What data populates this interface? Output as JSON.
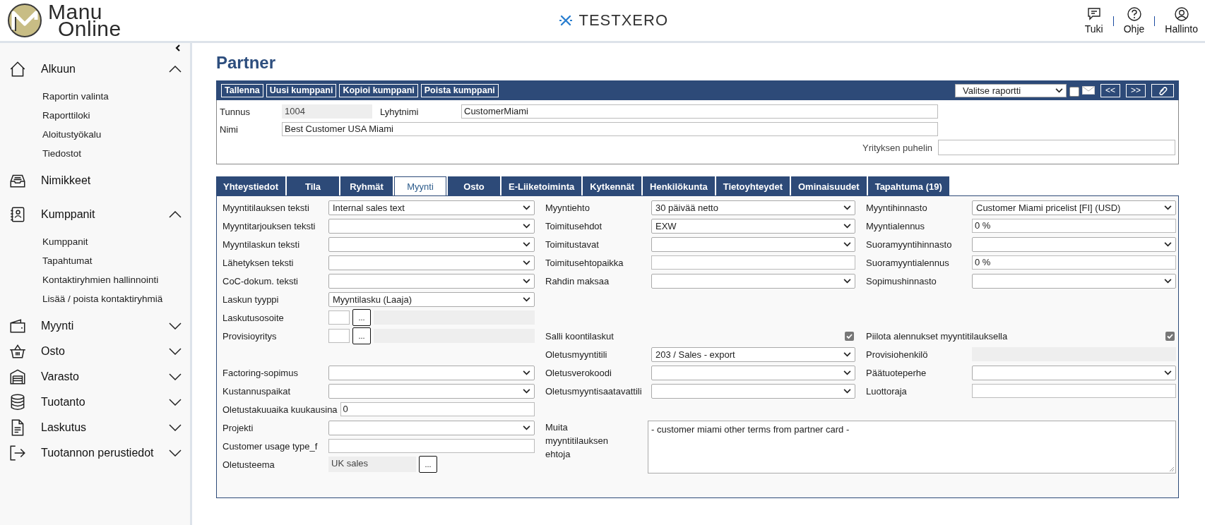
{
  "header": {
    "logo_text": [
      "Manu",
      "Online"
    ],
    "company": "TESTXERO",
    "links": [
      {
        "label": "Tuki"
      },
      {
        "label": "Ohje"
      },
      {
        "label": "Hallinto"
      }
    ]
  },
  "sidebar": {
    "items": [
      {
        "label": "Alkuun",
        "kind": "group",
        "expanded": true,
        "children": [
          {
            "label": "Raportin valinta"
          },
          {
            "label": "Raporttiloki"
          },
          {
            "label": "Aloitustyökalu"
          },
          {
            "label": "Tiedostot"
          }
        ]
      },
      {
        "label": "Nimikkeet",
        "kind": "link"
      },
      {
        "label": "Kumppanit",
        "kind": "group",
        "expanded": true,
        "children": [
          {
            "label": "Kumppanit"
          },
          {
            "label": "Tapahtumat"
          },
          {
            "label": "Kontaktiryhmien hallinnointi"
          },
          {
            "label": "Lisää / poista kontaktiryhmiä"
          }
        ]
      },
      {
        "label": "Myynti",
        "kind": "group",
        "expanded": false
      },
      {
        "label": "Osto",
        "kind": "group",
        "expanded": false
      },
      {
        "label": "Varasto",
        "kind": "group",
        "expanded": false
      },
      {
        "label": "Tuotanto",
        "kind": "group",
        "expanded": false
      },
      {
        "label": "Laskutus",
        "kind": "group",
        "expanded": false
      },
      {
        "label": "Tuotannon perustiedot",
        "kind": "group",
        "expanded": false
      }
    ]
  },
  "page": {
    "title": "Partner"
  },
  "toolbar": {
    "buttons": [
      "Tallenna",
      "Uusi kumppani",
      "Kopioi kumppani",
      "Poista kumppani"
    ],
    "report_select": {
      "value": "Valitse raportti"
    },
    "email_checkbox": {
      "checked": false
    },
    "nav_buttons": [
      "<<",
      ">>"
    ]
  },
  "header_fields": {
    "tunnus": {
      "label": "Tunnus",
      "value": "1004"
    },
    "lyhytnimi": {
      "label": "Lyhytnimi",
      "value": "CustomerMiami"
    },
    "nimi": {
      "label": "Nimi",
      "value": "Best Customer USA Miami"
    },
    "puhelin": {
      "label": "Yrityksen puhelin"
    }
  },
  "tabs": [
    {
      "label": "Yhteystiedot",
      "selected": false
    },
    {
      "label": "Tila",
      "selected": false
    },
    {
      "label": "Ryhmät",
      "selected": false
    },
    {
      "label": "Myynti",
      "selected": true
    },
    {
      "label": "Osto",
      "selected": false
    },
    {
      "label": "E-Liiketoiminta",
      "selected": false
    },
    {
      "label": "Kytkennät",
      "selected": false
    },
    {
      "label": "Henkilökunta",
      "selected": false
    },
    {
      "label": "Tietoyhteydet",
      "selected": false
    },
    {
      "label": "Ominaisuudet",
      "selected": false
    },
    {
      "label": "Tapahtuma (19)",
      "selected": false
    }
  ],
  "form": {
    "rows": [
      {
        "col_1": {
          "label": "Myyntitilauksen teksti",
          "kind": "select",
          "value": "Internal sales text"
        },
        "col_2": {
          "label": "Myyntiehto",
          "kind": "select",
          "value": "30 päivää netto"
        },
        "col_3": {
          "label": "Myyntihinnasto",
          "kind": "select",
          "value": "Customer Miami pricelist [FI] (USD)"
        }
      },
      {
        "col_1": {
          "label": "Myyntitarjouksen teksti",
          "kind": "select"
        },
        "col_2": {
          "label": "Toimitusehdot",
          "kind": "select",
          "value": "EXW"
        },
        "col_3": {
          "label": "Myyntialennus",
          "kind": "text",
          "value": "0 %"
        }
      },
      {
        "col_1": {
          "label": "Myyntilaskun teksti",
          "kind": "select"
        },
        "col_2": {
          "label": "Toimitustavat",
          "kind": "select"
        },
        "col_3": {
          "label": "Suoramyyntihinnasto",
          "kind": "select"
        }
      },
      {
        "col_1": {
          "label": "Lähetyksen teksti",
          "kind": "select"
        },
        "col_2": {
          "label": "Toimitusehtopaikka",
          "kind": "text"
        },
        "col_3": {
          "label": "Suoramyyntialennus",
          "kind": "text",
          "value": "0 %"
        }
      },
      {
        "col_1": {
          "label": "CoC-dokum. teksti",
          "kind": "select"
        },
        "col_2": {
          "label": "Rahdin maksaa",
          "kind": "select"
        },
        "col_3": {
          "label": "Sopimushinnasto",
          "kind": "select"
        }
      },
      {
        "col_1": {
          "label": "Laskun tyyppi",
          "kind": "select",
          "value": "Myyntilasku (Laaja)"
        }
      },
      {
        "col_1": {
          "label": "Laskutusosoite",
          "kind": "lookup",
          "button": "..."
        }
      },
      {
        "col_1": {
          "label": "Provisioyritys",
          "kind": "lookup",
          "button": "..."
        },
        "col_2": {
          "label": "Salli koontilaskut",
          "kind": "checkbox",
          "checked": true
        },
        "col_3": {
          "label": "Piilota alennukset myyntitilauksella",
          "kind": "checkbox",
          "checked": true
        }
      },
      {
        "col_2": {
          "label": "Oletusmyyntitili",
          "kind": "select",
          "value": "203 / Sales - export"
        },
        "col_3": {
          "label": "Provisiohenkilö",
          "kind": "readonly"
        }
      },
      {
        "col_1": {
          "label": "Factoring-sopimus",
          "kind": "select"
        },
        "col_2": {
          "label": "Oletusverokoodi",
          "kind": "select"
        },
        "col_3": {
          "label": "Päätuoteperhe",
          "kind": "select"
        }
      },
      {
        "col_1": {
          "label": "Kustannuspaikat",
          "kind": "select"
        },
        "col_2": {
          "label": "Oletusmyyntisaatavattili",
          "kind": "select"
        },
        "col_3": {
          "label": "Luottoraja",
          "kind": "text"
        }
      },
      {
        "col_1": {
          "label": "Oletustakuuaika kuukausina",
          "kind": "text",
          "value": "0"
        }
      },
      {
        "col_1": {
          "label": "Projekti",
          "kind": "select"
        },
        "col_2": {
          "label": "Muita myyntitilauksen ehtoja",
          "kind": "textarea",
          "value": "- customer miami other terms from partner card -"
        }
      },
      {
        "col_1": {
          "label": "Customer usage type_f",
          "kind": "text"
        }
      },
      {
        "col_1": {
          "label": "Oletusteema",
          "kind": "readonly_lookup",
          "value": "UK sales",
          "button": "..."
        }
      }
    ]
  }
}
